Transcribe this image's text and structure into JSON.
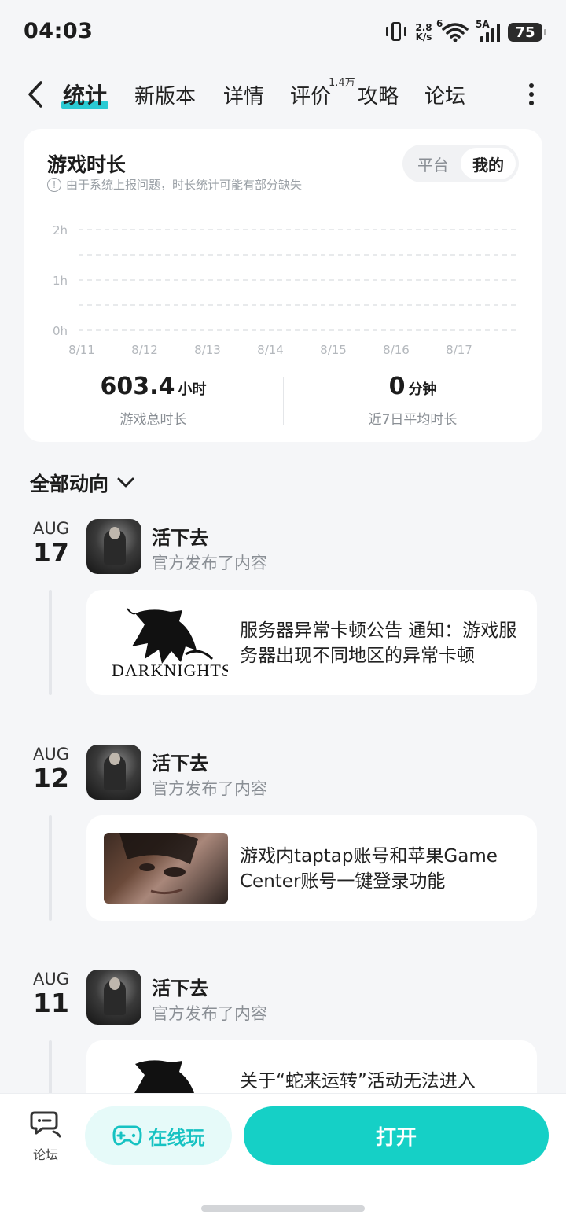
{
  "status": {
    "time": "04:03",
    "net_speed_top": "2.8",
    "net_speed_unit": "K/s",
    "wifi_label": "6",
    "cell_label": "5A",
    "battery": "75"
  },
  "nav": {
    "tabs": [
      {
        "label": "统计"
      },
      {
        "label": "新版本"
      },
      {
        "label": "详情"
      },
      {
        "label": "评价",
        "badge": "1.4万"
      },
      {
        "label": "攻略"
      },
      {
        "label": "论坛"
      }
    ]
  },
  "stats_card": {
    "title": "游戏时长",
    "note": "由于系统上报问题，时长统计可能有部分缺失",
    "toggle": {
      "platform": "平台",
      "mine": "我的"
    },
    "total": {
      "value": "603.4",
      "unit": "小时",
      "label": "游戏总时长"
    },
    "avg": {
      "value": "0",
      "unit": "分钟",
      "label": "近7日平均时长"
    }
  },
  "chart_data": {
    "type": "bar",
    "categories": [
      "8/11",
      "8/12",
      "8/13",
      "8/14",
      "8/15",
      "8/16",
      "8/17"
    ],
    "values": [
      0,
      0,
      0,
      0,
      0,
      0,
      0
    ],
    "yticks": [
      "0h",
      "1h",
      "2h"
    ],
    "ylim": [
      0,
      2
    ],
    "grid": true
  },
  "feed": {
    "filter_label": "全部动向",
    "entries": [
      {
        "month": "AUG",
        "day": "17",
        "game": "活下去",
        "action": "官方发布了内容",
        "post_text": "服务器异常卡顿公告 通知：游戏服务器出现不同地区的异常卡顿",
        "thumb": "dark-knights-logo"
      },
      {
        "month": "AUG",
        "day": "12",
        "game": "活下去",
        "action": "官方发布了内容",
        "post_text": "游戏内taptap账号和苹果Game Center账号一键登录功能",
        "thumb": "face-photo"
      },
      {
        "month": "AUG",
        "day": "11",
        "game": "活下去",
        "action": "官方发布了内容",
        "post_text": "关于“蛇来运转”活动无法进入",
        "thumb": "dark-knights-logo"
      }
    ]
  },
  "bottom": {
    "forum": "论坛",
    "online": "在线玩",
    "open": "打开"
  },
  "colors": {
    "accent": "#15d0c6",
    "background": "#f5f6f8"
  }
}
